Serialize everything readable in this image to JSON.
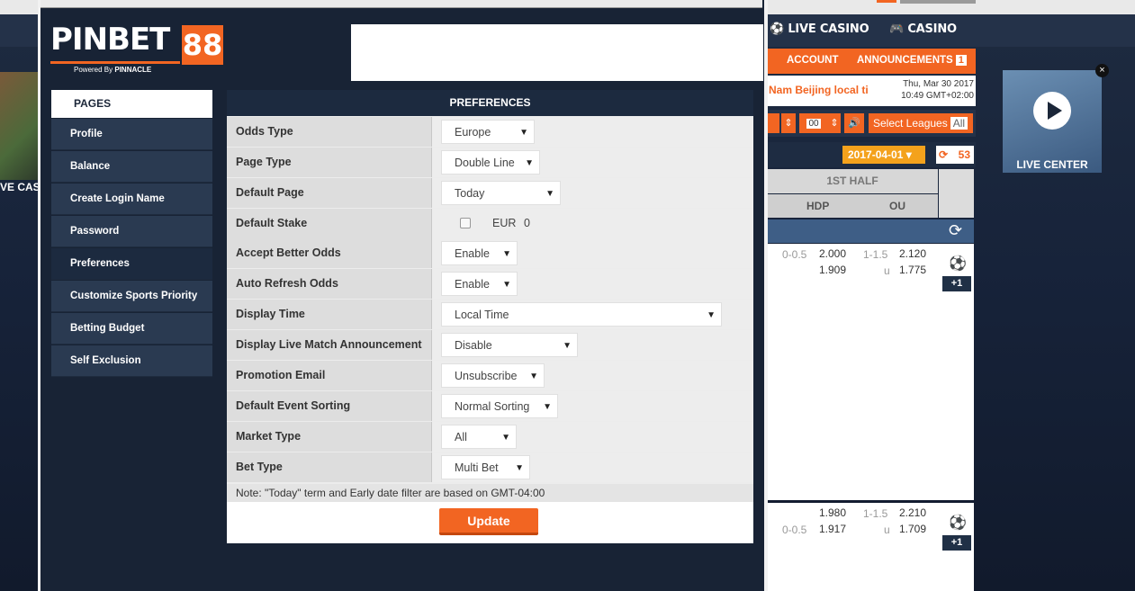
{
  "popup": {
    "logo_text": "PINBET",
    "logo_num": "88",
    "powered_by": "Powered By",
    "powered_brand": "PINNACLE",
    "sidebar": {
      "title": "PAGES",
      "items": [
        {
          "label": "Profile"
        },
        {
          "label": "Balance"
        },
        {
          "label": "Create Login Name"
        },
        {
          "label": "Password"
        },
        {
          "label": "Preferences",
          "active": true
        },
        {
          "label": "Customize Sports Priority"
        },
        {
          "label": "Betting Budget"
        },
        {
          "label": "Self Exclusion"
        }
      ]
    },
    "preferences": {
      "title": "PREFERENCES",
      "rows": [
        {
          "label": "Odds Type",
          "value": "Europe"
        },
        {
          "label": "Page Type",
          "value": "Double Line"
        },
        {
          "label": "Default Page",
          "value": "Today"
        },
        {
          "label": "Default Stake",
          "currency": "EUR",
          "value": "0",
          "checked": false
        },
        {
          "label": "Accept Better Odds",
          "value": "Enable"
        },
        {
          "label": "Auto Refresh Odds",
          "value": "Enable"
        },
        {
          "label": "Display Time",
          "value": "Local Time"
        },
        {
          "label": "Display Live Match Announcement",
          "value": "Disable"
        },
        {
          "label": "Promotion Email",
          "value": "Unsubscribe"
        },
        {
          "label": "Default Event Sorting",
          "value": "Normal Sorting"
        },
        {
          "label": "Market Type",
          "value": "All"
        },
        {
          "label": "Bet Type",
          "value": "Multi Bet"
        }
      ],
      "note": "Note: \"Today\" term and Early date filter are based on GMT-04:00",
      "update_label": "Update"
    }
  },
  "background": {
    "nav": {
      "live_casino": "LIVE CASINO",
      "casino": "CASINO"
    },
    "left_casino_text": "VE CASI",
    "account": "ACCOUNT",
    "announcements": "ANNOUNCEMENTS",
    "announcements_count": "1",
    "ticker": "Nam Beijing local ti",
    "clock_date": "Thu, Mar 30 2017",
    "clock_time": "10:49 GMT+02:00",
    "stake_mini": "00",
    "select_leagues": "Select Leagues",
    "select_leagues_value": "All",
    "date": "2017-04-01",
    "count": "53",
    "first_half": "1ST HALF",
    "hdp": "HDP",
    "ou": "OU",
    "live_center": "LIVE CENTER",
    "odds_rows": [
      {
        "hdp_line": "0-0.5",
        "hdp_top": "2.000",
        "hdp_bot": "1.909",
        "ou_line": "1-1.5",
        "ou_u": "u",
        "ou_top": "2.120",
        "ou_bot": "1.775",
        "plus": "+1"
      },
      {
        "hdp_line": "0-0.5",
        "hdp_top": "1.980",
        "hdp_bot": "1.917",
        "ou_line": "1-1.5",
        "ou_u": "u",
        "ou_top": "2.210",
        "ou_bot": "1.709",
        "plus": "+1"
      }
    ]
  }
}
